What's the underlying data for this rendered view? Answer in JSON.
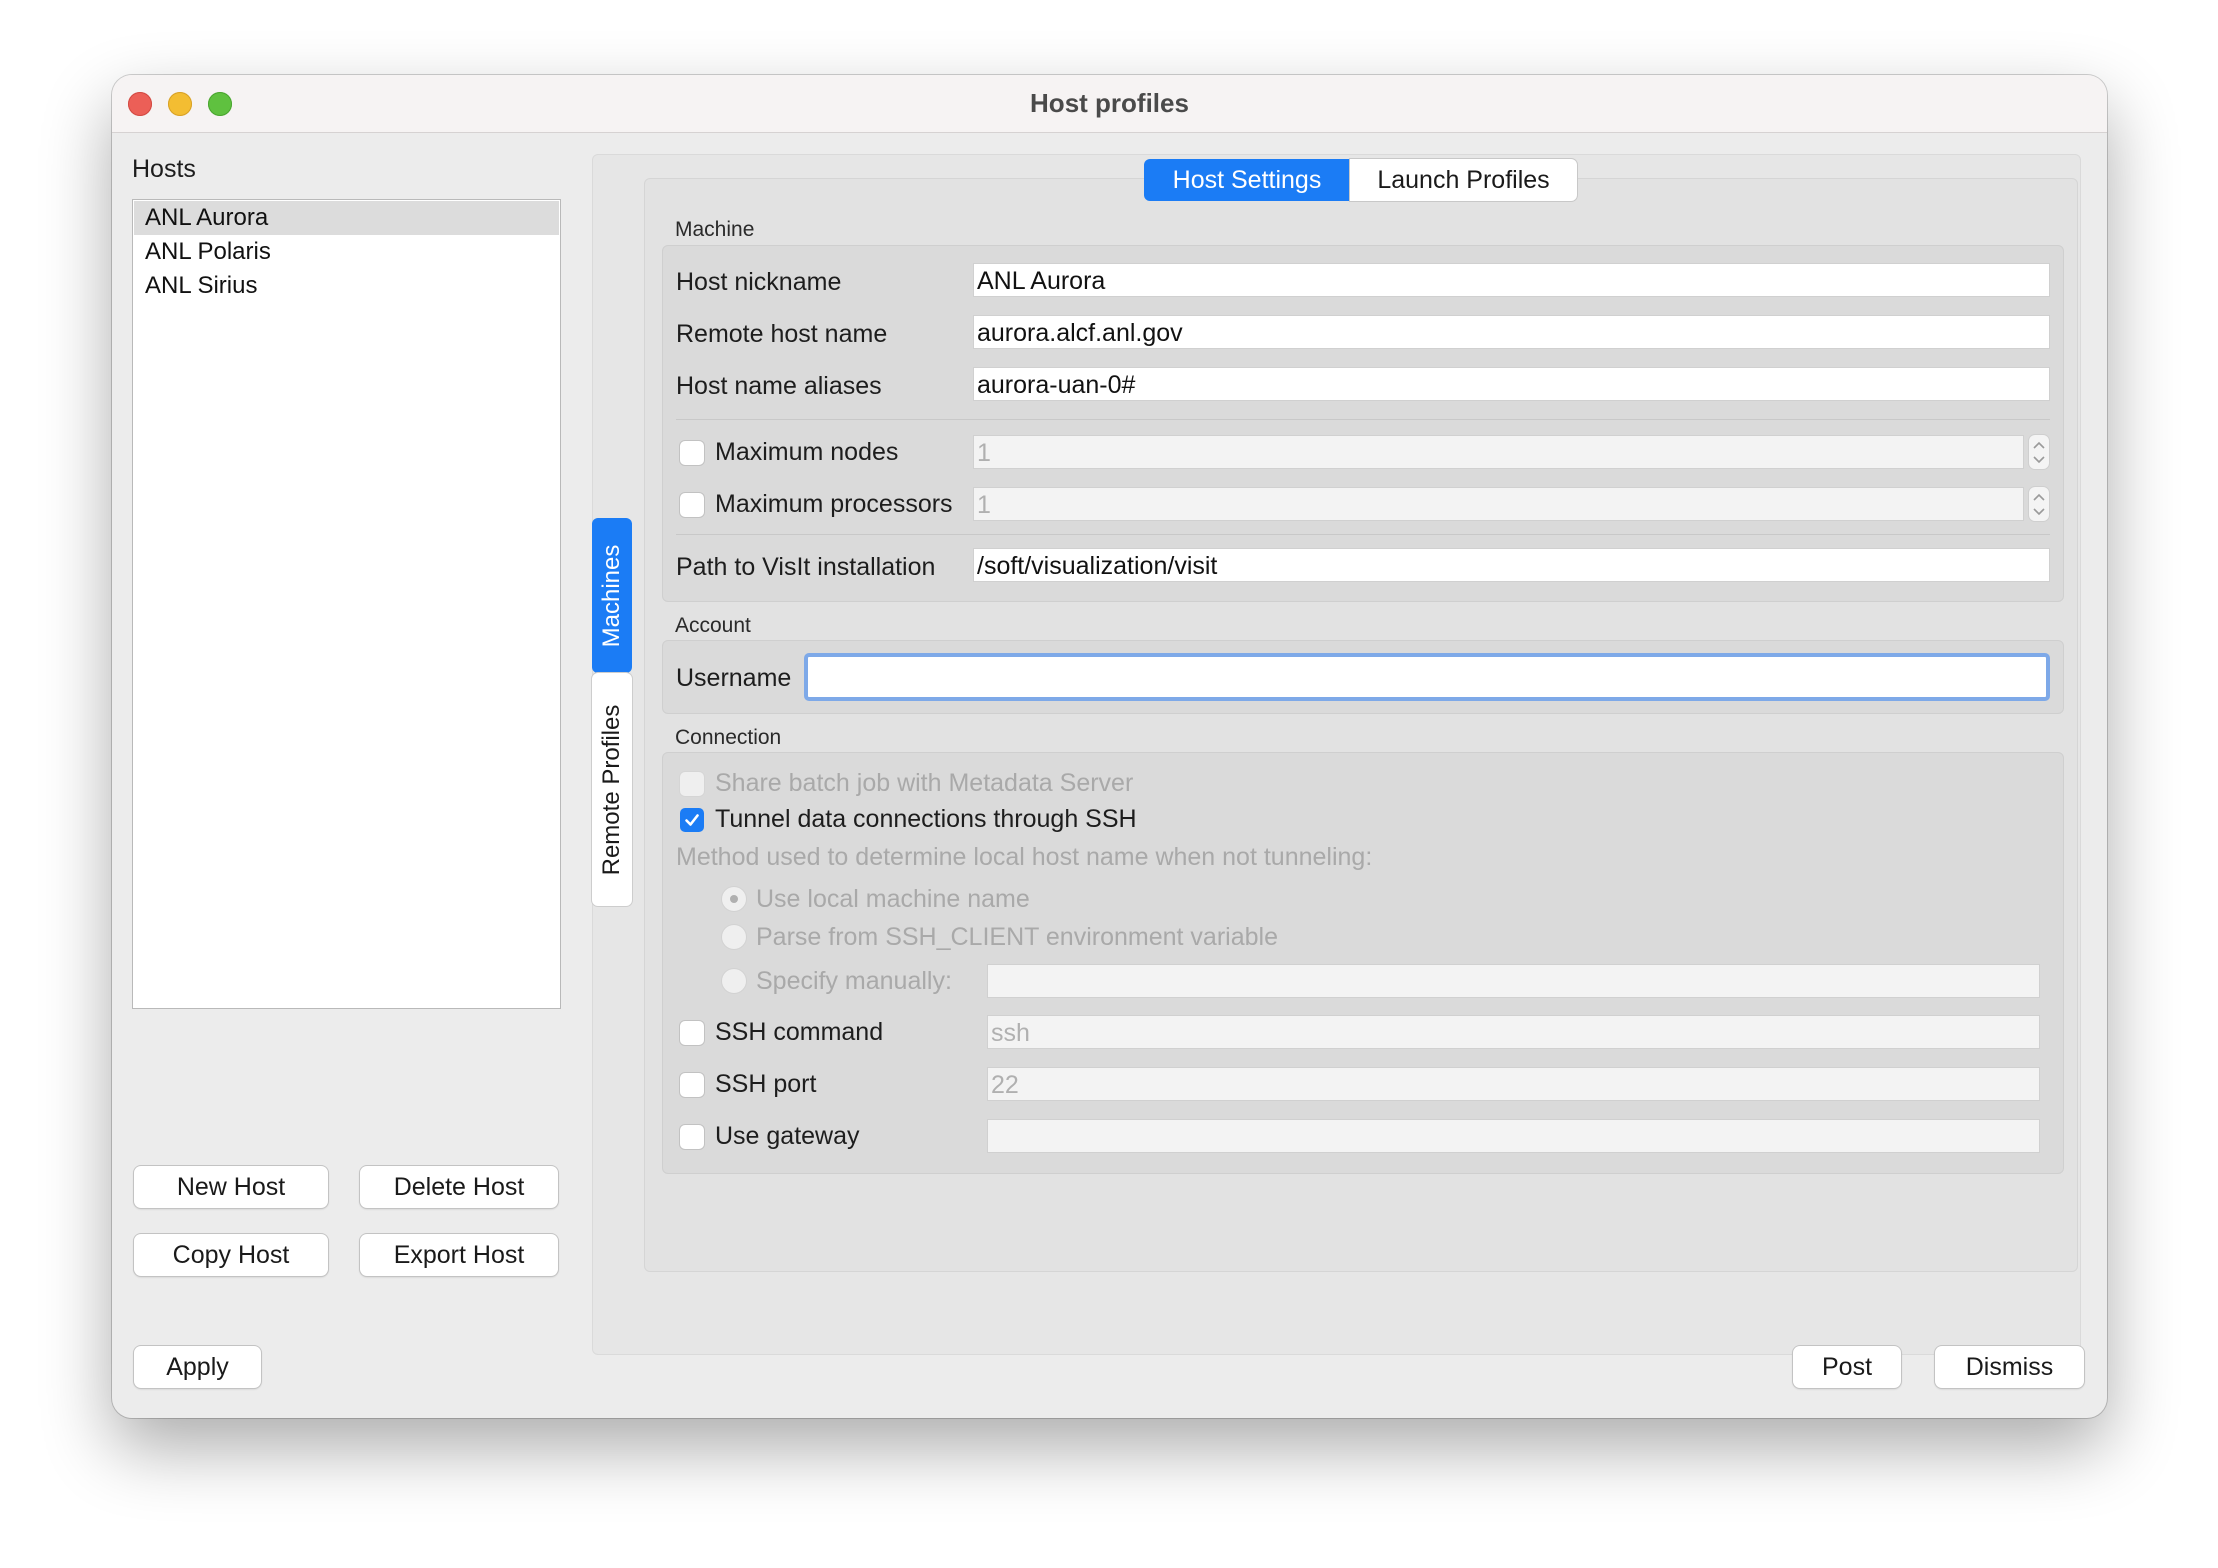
{
  "window": {
    "title": "Host profiles"
  },
  "hosts": {
    "label": "Hosts",
    "items": [
      {
        "label": "ANL Aurora",
        "selected": true
      },
      {
        "label": "ANL Polaris",
        "selected": false
      },
      {
        "label": "ANL Sirius",
        "selected": false
      }
    ],
    "buttons": {
      "new": "New Host",
      "delete": "Delete Host",
      "copy": "Copy Host",
      "export": "Export Host"
    }
  },
  "side_tabs": {
    "machines": "Machines",
    "remote_profiles": "Remote Profiles"
  },
  "tabs": {
    "host_settings": "Host Settings",
    "launch_profiles": "Launch Profiles"
  },
  "machine": {
    "heading": "Machine",
    "host_nickname": {
      "label": "Host nickname",
      "value": "ANL Aurora"
    },
    "remote_host_name": {
      "label": "Remote host name",
      "value": "aurora.alcf.anl.gov"
    },
    "host_name_aliases": {
      "label": "Host name aliases",
      "value": "aurora-uan-0#"
    },
    "max_nodes": {
      "label": "Maximum nodes",
      "value": "1",
      "checked": false
    },
    "max_processors": {
      "label": "Maximum processors",
      "value": "1",
      "checked": false
    },
    "visit_path": {
      "label": "Path to VisIt installation",
      "value": "/soft/visualization/visit"
    }
  },
  "account": {
    "heading": "Account",
    "username": {
      "label": "Username",
      "value": ""
    }
  },
  "connection": {
    "heading": "Connection",
    "share_batch": {
      "label": "Share batch job with Metadata Server",
      "checked": false,
      "enabled": false
    },
    "tunnel_ssh": {
      "label": "Tunnel data connections through SSH",
      "checked": true
    },
    "method_label": "Method used to determine local host name when not tunneling:",
    "radio_local": "Use local machine name",
    "radio_parse": "Parse from SSH_CLIENT environment variable",
    "radio_manual": "Specify manually:",
    "manual_value": "",
    "ssh_command": {
      "label": "SSH command",
      "value": "ssh",
      "checked": false
    },
    "ssh_port": {
      "label": "SSH port",
      "value": "22",
      "checked": false
    },
    "gateway": {
      "label": "Use gateway",
      "value": "",
      "checked": false
    }
  },
  "footer": {
    "apply": "Apply",
    "post": "Post",
    "dismiss": "Dismiss"
  },
  "colors": {
    "accent": "#1b7cf5",
    "focus_ring": "#7ea9e8"
  }
}
